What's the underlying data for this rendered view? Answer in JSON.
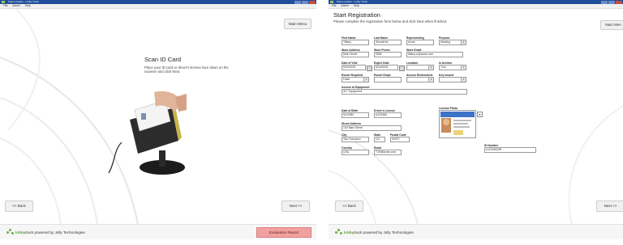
{
  "colors": {
    "titlebar": "#1f4e9a",
    "eval_button": "#f2a0a0",
    "brand_green": "#5aa13e"
  },
  "screen1": {
    "window_title": "Pass Location - Lobby Track",
    "menu": [
      "File",
      "Admin",
      "Help"
    ],
    "main_menu_button": "Main Menu",
    "heading": "Scan ID Card",
    "instruction": "Place your ID card or driver's license face down on the scanner and click Next.",
    "scanner_image": "id-card-scanner",
    "back_button": "<< Back",
    "next_button": "Next >>",
    "footer_brand_green": "lobby",
    "footer_brand_rest": " track powered by Jolly Technologies",
    "eval_button": "Evaluation Report"
  },
  "screen2": {
    "window_title": "Pass Location - Lobby Track",
    "menu": [
      "File",
      "Admin",
      "Help"
    ],
    "main_menu_button": "Main Men",
    "heading": "Start Registration",
    "instruction": "Please complete the registration form below and click Next when finished.",
    "fields": {
      "first_name": {
        "label": "First Name",
        "value": "Tiffany"
      },
      "last_name": {
        "label": "Last Name",
        "value": "Wonderful"
      },
      "representing": {
        "label": "Representing",
        "value": "Acme"
      },
      "purpose": {
        "label": "Purpose",
        "value": "Meeting"
      },
      "work_address": {
        "label": "Work Address",
        "value": "Main Street"
      },
      "work_phone": {
        "label": "Work Phone",
        "value": "5555"
      },
      "work_email": {
        "label": "Work Email",
        "value": "tiffany.w@acme.com"
      },
      "date_of_visit": {
        "label": "Date of Visit",
        "value": "8/24/2008"
      },
      "expire_date": {
        "label": "Expire Date",
        "value": "8/24/2008"
      },
      "location": {
        "label": "Location",
        "value": ""
      },
      "in_archive": {
        "label": "In Archive",
        "value": "True"
      },
      "escort_required": {
        "label": "Escort Required",
        "value": "False"
      },
      "escort_emp": {
        "label": "Escort Emp#",
        "value": ""
      },
      "access_restrictions": {
        "label": "Access Restrictions",
        "value": ""
      },
      "key_issued": {
        "label": "Key Issued",
        "value": ""
      },
      "access_to_equipment": {
        "label": "Access to Equipment",
        "value": "ALT Equipment"
      },
      "date_of_birth": {
        "label": "Date of Birth",
        "value": "5/1/1980"
      },
      "driver_license": {
        "label": "Driver's License",
        "value": "A123456"
      },
      "street_address": {
        "label": "Street Address",
        "value": "100 Main Street"
      },
      "city": {
        "label": "City",
        "value": "San Francisco"
      },
      "state": {
        "label": "State",
        "value": "CA"
      },
      "postal_code": {
        "label": "Postal Code",
        "value": "94070"
      },
      "country": {
        "label": "Country",
        "value": "USA"
      },
      "email": {
        "label": "Email",
        "value": "T.W@acme.com"
      },
      "license_photo": {
        "label": "License Photo",
        "value": ""
      },
      "id_number": {
        "label": "ID Number",
        "value": "A123456789"
      }
    },
    "back_button": "<< Back",
    "next_button": "Next >>",
    "footer_brand_green": "lobby",
    "footer_brand_rest": " track powered by Jolly Technologies"
  }
}
